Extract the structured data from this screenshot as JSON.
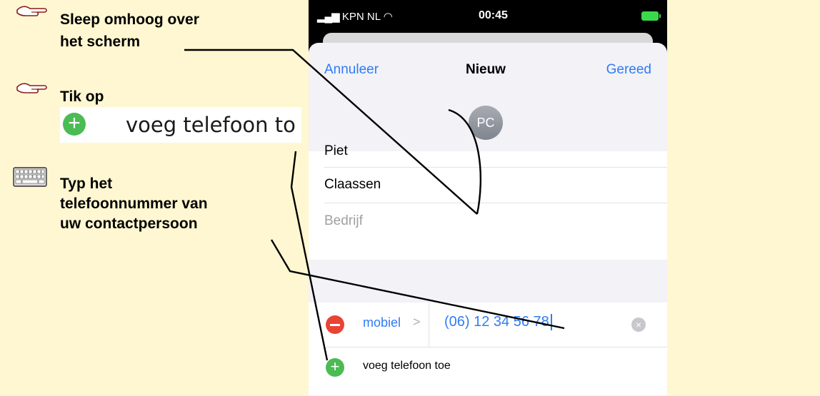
{
  "instructions": {
    "step1": {
      "line1": "Sleep omhoog over",
      "line2": "het scherm",
      "icon": "pointing-hand-icon"
    },
    "step2": {
      "line1": "Tik op",
      "icon": "pointing-hand-icon",
      "callout": {
        "icon": "plus-circle-icon",
        "label": "voeg telefoon to"
      }
    },
    "step3": {
      "line1": "Typ het",
      "line2": "telefoonnummer van",
      "line3": "uw contactpersoon",
      "icon": "keyboard-icon"
    }
  },
  "phone": {
    "status": {
      "carrier": "KPN NL",
      "time": "00:45"
    },
    "nav": {
      "cancel": "Annuleer",
      "title": "Nieuw",
      "done": "Gereed"
    },
    "avatar_initials": "PC",
    "fields": {
      "first_name": "Piet",
      "last_name": "Claassen",
      "company_placeholder": "Bedrijf"
    },
    "phone_entry": {
      "label": "mobiel",
      "chevron": ">",
      "value": "(06) 12 34 56 78"
    },
    "add_phone_label": "voeg telefoon toe"
  },
  "colors": {
    "background": "#fff7d1",
    "ios_blue": "#2f7cf6",
    "add_green": "#4bbb54",
    "remove_red": "#ea4335"
  }
}
